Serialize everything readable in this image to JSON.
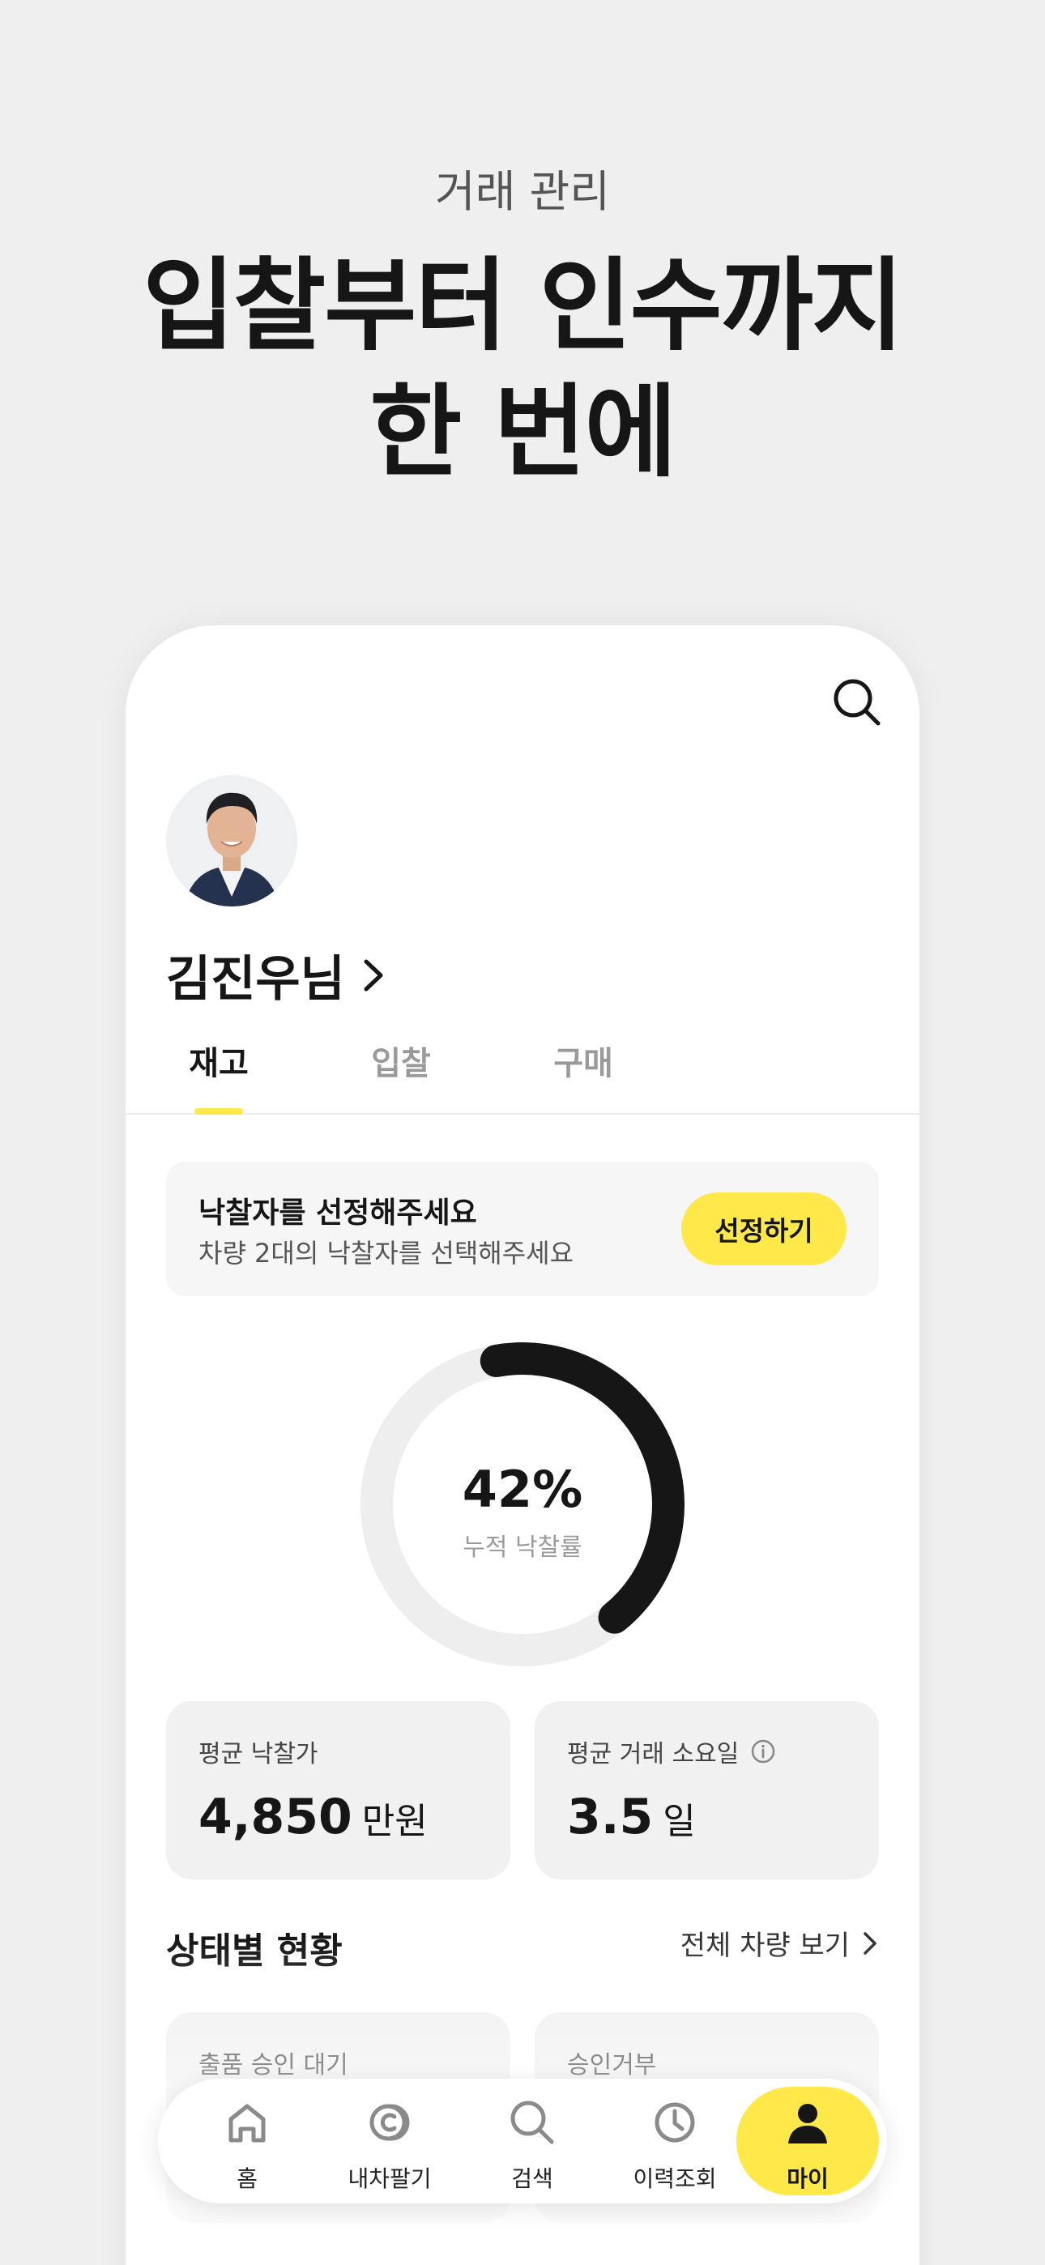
{
  "hero": {
    "subtitle": "거래 관리",
    "title_line1": "입찰부터 인수까지",
    "title_line2": "한 번에"
  },
  "user": {
    "name": "김진우님"
  },
  "tabs": [
    {
      "label": "재고",
      "active": true
    },
    {
      "label": "입찰",
      "active": false
    },
    {
      "label": "구매",
      "active": false
    }
  ],
  "notice": {
    "title": "낙찰자를 선정해주세요",
    "description": "차량 2대의 낙찰자를 선택해주세요",
    "button_label": "선정하기"
  },
  "donut": {
    "percent_text": "42%",
    "value": 0.42,
    "label": "누적 낙찰률"
  },
  "stats": [
    {
      "label": "평균 낙찰가",
      "value": "4,850",
      "unit": "만원",
      "has_info": false
    },
    {
      "label": "평균 거래 소요일",
      "value": "3.5",
      "unit": "일",
      "has_info": true
    }
  ],
  "status_section": {
    "title": "상태별 현황",
    "view_all": "전체 차량 보기",
    "cards": [
      {
        "label": "출품 승인 대기"
      },
      {
        "label": "승인거부"
      }
    ]
  },
  "tabbar": [
    {
      "label": "홈",
      "icon": "home-icon",
      "active": false
    },
    {
      "label": "내차팔기",
      "icon": "sell-car-icon",
      "active": false
    },
    {
      "label": "검색",
      "icon": "search-icon",
      "active": false
    },
    {
      "label": "이력조회",
      "icon": "clock-icon",
      "active": false
    },
    {
      "label": "마이",
      "icon": "person-icon",
      "active": true
    }
  ],
  "colors": {
    "accent": "#ffe94a",
    "text": "#161616",
    "background": "#efefef",
    "donut_track": "#eeeeee"
  }
}
